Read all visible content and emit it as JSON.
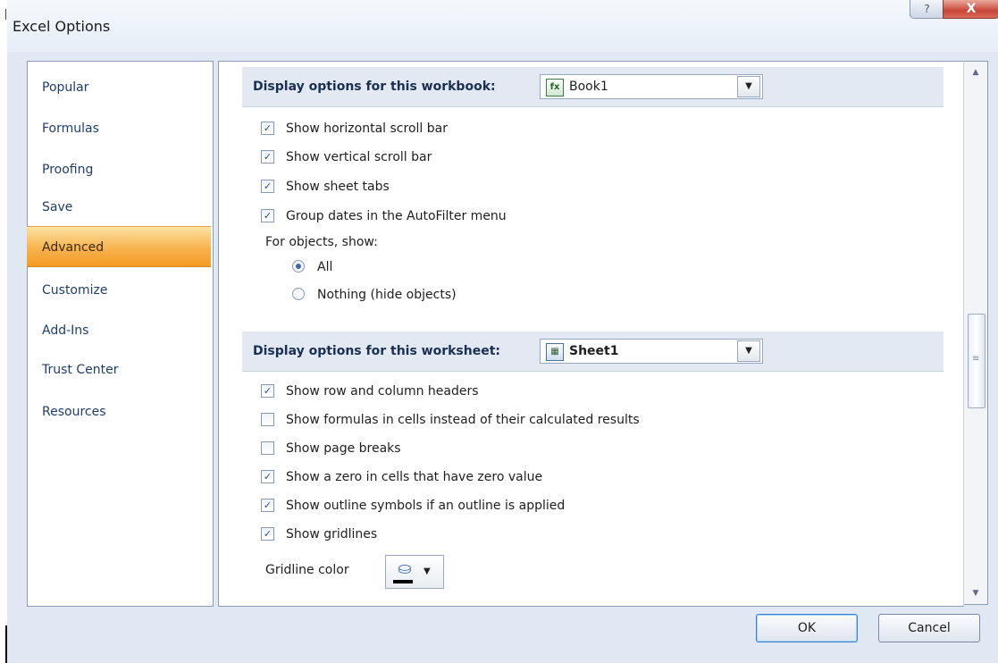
{
  "window": {
    "title": "Excel Options",
    "help_glyph": "?",
    "close_glyph": "X"
  },
  "nav": {
    "items": [
      {
        "label": "Popular"
      },
      {
        "label": "Formulas"
      },
      {
        "label": "Proofing"
      },
      {
        "label": "Save"
      },
      {
        "label": "Advanced",
        "selected": true
      },
      {
        "label": "Customize"
      },
      {
        "label": "Add-Ins"
      },
      {
        "label": "Trust Center"
      },
      {
        "label": "Resources"
      }
    ]
  },
  "workbook_section": {
    "label": "Display options for this workbook:",
    "combo_value": "Book1",
    "combo_icon": "excel-book-icon",
    "options": [
      {
        "label": "Show horizontal scroll bar",
        "checked": true
      },
      {
        "label": "Show vertical scroll bar",
        "checked": true
      },
      {
        "label": "Show sheet tabs",
        "checked": true
      },
      {
        "label": "Group dates in the AutoFilter menu",
        "checked": true
      }
    ],
    "objects_label": "For objects, show:",
    "radios": [
      {
        "label": "All",
        "selected": true
      },
      {
        "label": "Nothing (hide objects)",
        "selected": false
      }
    ]
  },
  "worksheet_section": {
    "label": "Display options for this worksheet:",
    "combo_value": "Sheet1",
    "combo_icon": "worksheet-icon",
    "options": [
      {
        "label": "Show row and column headers",
        "checked": true
      },
      {
        "label": "Show formulas in cells instead of their calculated results",
        "checked": false
      },
      {
        "label": "Show page breaks",
        "checked": false
      },
      {
        "label": "Show a zero in cells that have zero value",
        "checked": true
      },
      {
        "label": "Show outline symbols if an outline is applied",
        "checked": true
      },
      {
        "label": "Show gridlines",
        "checked": true
      }
    ],
    "gridline_color_label": "Gridline color",
    "gridline_color": "#000000"
  },
  "buttons": {
    "ok": "OK",
    "cancel": "Cancel"
  },
  "colors": {
    "nav_selected": "#f8b24e",
    "section_header_bg": "#e3e9f2",
    "dialog_bg": "#dfe8f3"
  }
}
